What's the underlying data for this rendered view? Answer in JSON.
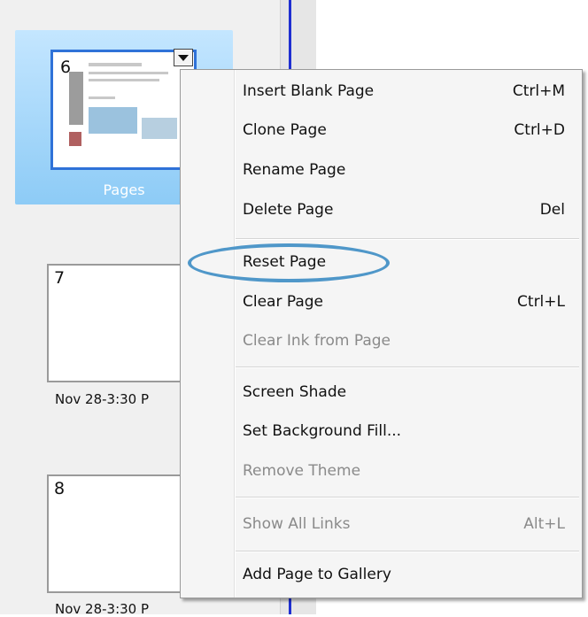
{
  "sorter": {
    "pages": [
      {
        "number": "6",
        "label": "Pages",
        "selected": true
      },
      {
        "number": "7",
        "label": "Nov 28-3:30 P",
        "selected": false
      },
      {
        "number": "8",
        "label": "Nov 28-3:30 P",
        "selected": false
      }
    ]
  },
  "menu": {
    "items": [
      {
        "label": "Insert Blank Page",
        "shortcut": "Ctrl+M",
        "enabled": true
      },
      {
        "label": "Clone Page",
        "shortcut": "Ctrl+D",
        "enabled": true
      },
      {
        "label": "Rename Page",
        "shortcut": "",
        "enabled": true
      },
      {
        "label": "Delete Page",
        "shortcut": "Del",
        "enabled": true
      },
      {
        "label": "Reset Page",
        "shortcut": "",
        "enabled": true
      },
      {
        "label": "Clear Page",
        "shortcut": "Ctrl+L",
        "enabled": true
      },
      {
        "label": "Clear Ink from Page",
        "shortcut": "",
        "enabled": false
      },
      {
        "label": "Screen Shade",
        "shortcut": "",
        "enabled": true
      },
      {
        "label": "Set Background Fill...",
        "shortcut": "",
        "enabled": true
      },
      {
        "label": "Remove Theme",
        "shortcut": "",
        "enabled": false
      },
      {
        "label": "Show All Links",
        "shortcut": "Alt+L",
        "enabled": false
      },
      {
        "label": "Add Page to Gallery",
        "shortcut": "",
        "enabled": true
      }
    ],
    "highlighted_item": "Reset Page"
  },
  "colors": {
    "accent": "#2f72d8",
    "highlight_ring": "#4f97c9",
    "selected_bg": "#8dcbf6"
  }
}
